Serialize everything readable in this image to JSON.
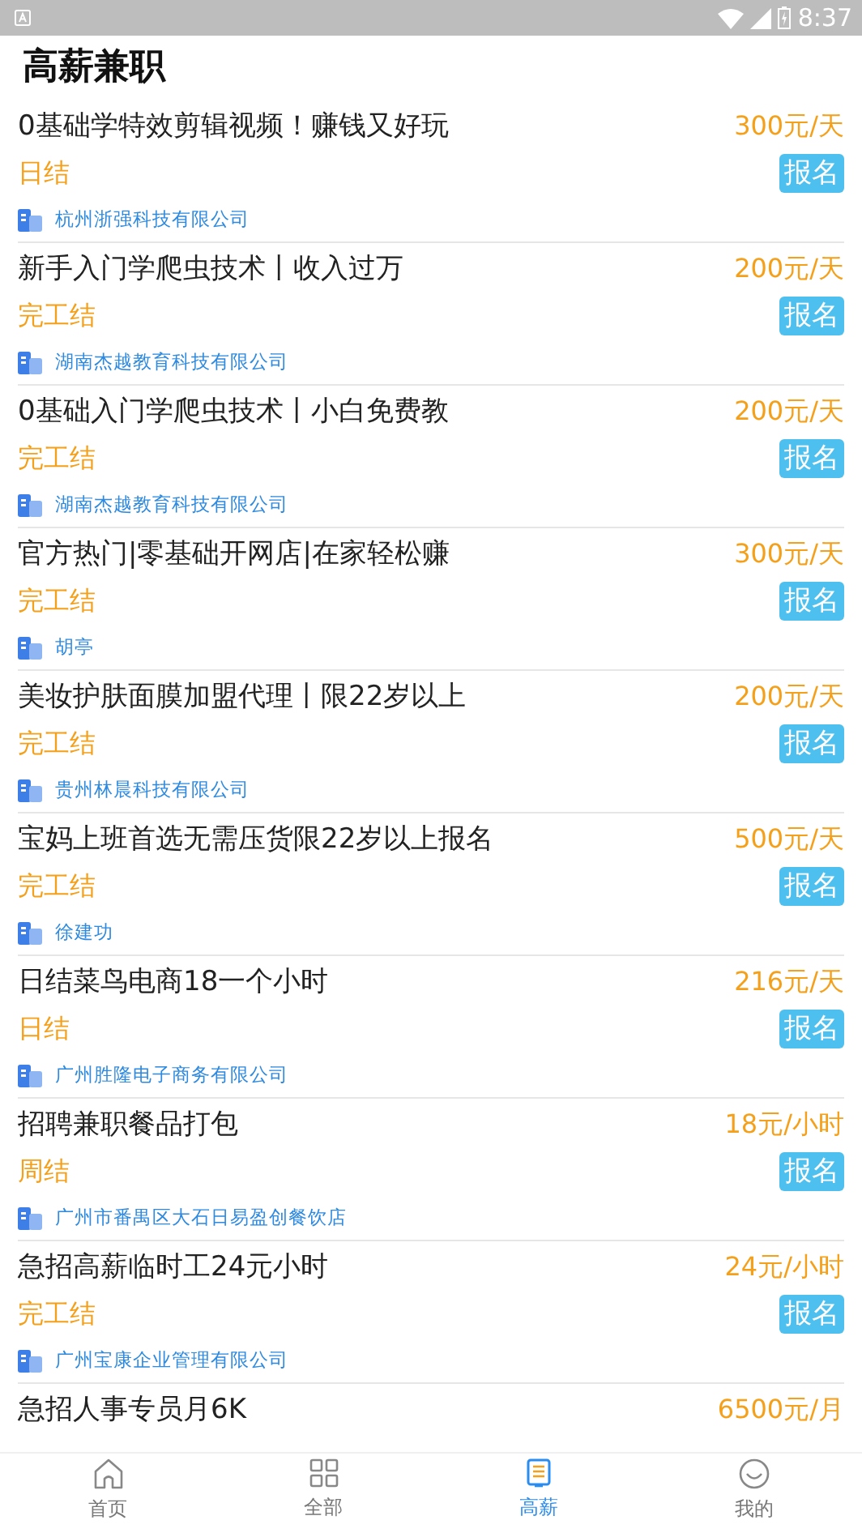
{
  "status_bar": {
    "time": "8:37"
  },
  "header": {
    "title": "高薪兼职"
  },
  "jobs": [
    {
      "title": "0基础学特效剪辑视频！赚钱又好玩",
      "pay": "300元/天",
      "settlement": "日结",
      "apply": "报名",
      "company": "杭州浙强科技有限公司"
    },
    {
      "title": "新手入门学爬虫技术丨收入过万",
      "pay": "200元/天",
      "settlement": "完工结",
      "apply": "报名",
      "company": "湖南杰越教育科技有限公司"
    },
    {
      "title": "0基础入门学爬虫技术丨小白免费教",
      "pay": "200元/天",
      "settlement": "完工结",
      "apply": "报名",
      "company": "湖南杰越教育科技有限公司"
    },
    {
      "title": "官方热门|零基础开网店|在家轻松赚",
      "pay": "300元/天",
      "settlement": "完工结",
      "apply": "报名",
      "company": "胡亭"
    },
    {
      "title": "美妆护肤面膜加盟代理丨限22岁以上",
      "pay": "200元/天",
      "settlement": "完工结",
      "apply": "报名",
      "company": "贵州林晨科技有限公司"
    },
    {
      "title": "宝妈上班首选无需压货限22岁以上报名",
      "pay": "500元/天",
      "settlement": "完工结",
      "apply": "报名",
      "company": "徐建功"
    },
    {
      "title": "日结菜鸟电商18一个小时",
      "pay": "216元/天",
      "settlement": "日结",
      "apply": "报名",
      "company": "广州胜隆电子商务有限公司"
    },
    {
      "title": "招聘兼职餐品打包",
      "pay": "18元/小时",
      "settlement": "周结",
      "apply": "报名",
      "company": "广州市番禺区大石日易盈创餐饮店"
    },
    {
      "title": "急招高薪临时工24元小时",
      "pay": "24元/小时",
      "settlement": "完工结",
      "apply": "报名",
      "company": "广州宝康企业管理有限公司"
    },
    {
      "title": "急招人事专员月6K",
      "pay": "6500元/月"
    }
  ],
  "tab_bar": [
    {
      "label": "首页",
      "kind": "home",
      "selected": false
    },
    {
      "label": "全部",
      "kind": "grid",
      "selected": false
    },
    {
      "label": "高薪",
      "kind": "doc",
      "selected": true
    },
    {
      "label": "我的",
      "kind": "smile",
      "selected": false
    }
  ]
}
